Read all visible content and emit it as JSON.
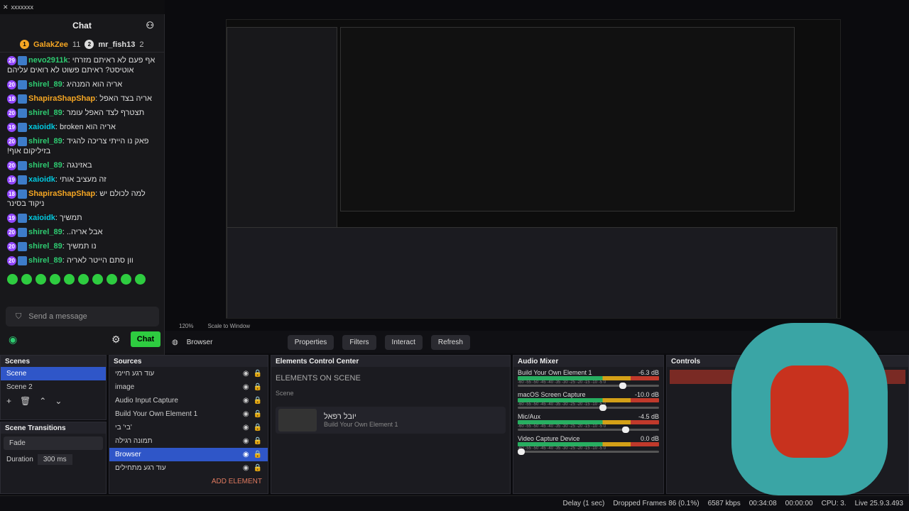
{
  "window": {
    "title": "xxxxxxx"
  },
  "chat": {
    "header": "Chat",
    "leaders": [
      {
        "name": "GalakZee",
        "count": "11"
      },
      {
        "name": "mr_fish13",
        "count": "2"
      }
    ],
    "messages": [
      {
        "badge": "29",
        "user": "nevo2911k",
        "text": "אף פעם לא ראיתם מזרחי אוטיסט? ראיתם פשוט לא רואים עליהם",
        "color": "#2ecc71"
      },
      {
        "badge": "20",
        "user": "shirel_89",
        "text": "אריה הוא המנהיג",
        "color": "#2ecc71"
      },
      {
        "badge": "18",
        "user": "ShapiraShapShap",
        "text": "אריה בצד האפל",
        "color": "#f5a623"
      },
      {
        "badge": "20",
        "user": "shirel_89",
        "text": "תצטרף לצד האפל עומר",
        "color": "#2ecc71"
      },
      {
        "badge": "19",
        "user": "xaioidk",
        "text": "אריה הוא broken",
        "color": "#00c9e0"
      },
      {
        "badge": "20",
        "user": "shirel_89",
        "text": "פאק נו הייתי צריכה להגיד בזיליקום אוף!",
        "color": "#2ecc71"
      },
      {
        "badge": "20",
        "user": "shirel_89",
        "text": "באזינגה",
        "color": "#2ecc71"
      },
      {
        "badge": "19",
        "user": "xaioidk",
        "text": "זה מעציב אותי",
        "color": "#00c9e0"
      },
      {
        "badge": "18",
        "user": "ShapiraShapShap",
        "text": "למה לכולם יש ניקוד בסינר",
        "color": "#f5a623"
      },
      {
        "badge": "19",
        "user": "xaioidk",
        "text": "תמשיך",
        "color": "#00c9e0"
      },
      {
        "badge": "20",
        "user": "shirel_89",
        "text": "אבל אריה..",
        "color": "#2ecc71"
      },
      {
        "badge": "20",
        "user": "shirel_89",
        "text": "נו תמשיך",
        "color": "#2ecc71"
      },
      {
        "badge": "20",
        "user": "shirel_89",
        "text": "וון סתם הייטר לאריה",
        "color": "#2ecc71"
      }
    ],
    "send_placeholder": "Send a message",
    "chat_button": "Chat"
  },
  "toolbar": {
    "zoom": "120%",
    "scale": "Scale to Window"
  },
  "source_bar": {
    "name": "Browser",
    "properties": "Properties",
    "filters": "Filters",
    "interact": "Interact",
    "refresh": "Refresh"
  },
  "scenes": {
    "title": "Scenes",
    "items": [
      "Scene",
      "Scene 2"
    ]
  },
  "transitions": {
    "title": "Scene Transitions",
    "type": "Fade",
    "duration_label": "Duration",
    "duration": "300 ms"
  },
  "sources": {
    "title": "Sources",
    "items": [
      "עוד רגע חיימי",
      "image",
      "Audio Input Capture",
      "Build Your Own Element 1",
      "בי' בי'",
      "תמונה רגילה",
      "Browser",
      "עוד רגע מתחילים"
    ],
    "add": "ADD ELEMENT"
  },
  "ecc": {
    "title": "Elements Control Center",
    "heading": "ELEMENTS ON SCENE",
    "scene": "Scene",
    "card_title": "יובל רפאל",
    "card_sub": "Build Your Own Element 1"
  },
  "mixer": {
    "title": "Audio Mixer",
    "channels": [
      {
        "name": "Build Your Own Element 1",
        "db": "-6.3 dB",
        "level": 0.72
      },
      {
        "name": "macOS Screen Capture",
        "db": "-10.0 dB",
        "level": 0.58
      },
      {
        "name": "Mic/Aux",
        "db": "-4.5 dB",
        "level": 0.74
      },
      {
        "name": "Video Capture Device",
        "db": "0.0 dB",
        "level": 0
      }
    ],
    "ticks": "-60 -55 -50 -45 -40 -35 -30 -25 -20 -15 -10 -5 0"
  },
  "controls": {
    "title": "Controls"
  },
  "status": {
    "delay": "Delay (1 sec)",
    "frames": "Dropped Frames 86 (0.1%)",
    "kbps": "6587 kbps",
    "rec_time": "00:34:08",
    "stream_time": "00:00:00",
    "cpu": "CPU: 3.",
    "version": "Live 25.9.3.493"
  }
}
